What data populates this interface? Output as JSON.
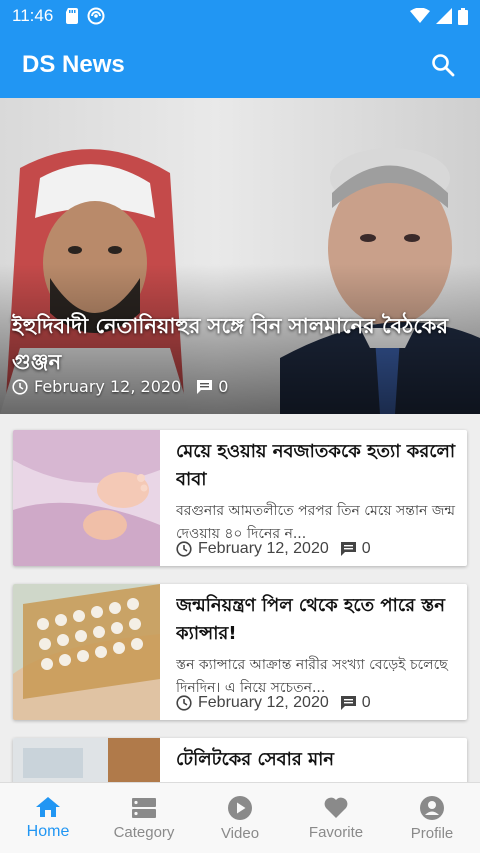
{
  "status_bar": {
    "time": "11:46",
    "icons_left": [
      "sd-card-icon",
      "app-notification-icon"
    ],
    "icons_right": [
      "wifi-icon",
      "signal-icon",
      "battery-icon"
    ]
  },
  "app_bar": {
    "title": "DS News",
    "search_icon": "search-icon",
    "color": "#2196f3"
  },
  "featured": {
    "title": "ইহুদিবাদী নেতানিয়াহুর সঙ্গে বিন সালমানের বৈঠকের গুঞ্জন",
    "date": "February 12, 2020",
    "comments": "0"
  },
  "articles": [
    {
      "title": "মেয়ে হওয়ায় নবজাতককে হত্যা করলো বাবা",
      "excerpt": "বরগুনার আমতলীতে পরপর তিন মেয়ে সন্তান জন্ম দেওয়ায় ৪০ দিনের ন...",
      "date": "February 12, 2020",
      "comments": "0"
    },
    {
      "title": "জন্মনিয়ন্ত্রণ পিল থেকে হতে পারে স্তন ক্যান্সার!",
      "excerpt": "স্তন ক্যান্সারে আক্রান্ত নারীর সংখ্যা বেড়েই চলেছে দিনদিন। এ নিয়ে সচেতন...",
      "date": "February 12, 2020",
      "comments": "0"
    },
    {
      "title": "টেলিটকের সেবার মান",
      "excerpt": "",
      "date": "",
      "comments": ""
    }
  ],
  "bottom_nav": [
    {
      "label": "Home",
      "icon": "home-icon",
      "active": true
    },
    {
      "label": "Category",
      "icon": "category-icon",
      "active": false
    },
    {
      "label": "Video",
      "icon": "play-icon",
      "active": false
    },
    {
      "label": "Favorite",
      "icon": "heart-icon",
      "active": false
    },
    {
      "label": "Profile",
      "icon": "profile-icon",
      "active": false
    }
  ]
}
